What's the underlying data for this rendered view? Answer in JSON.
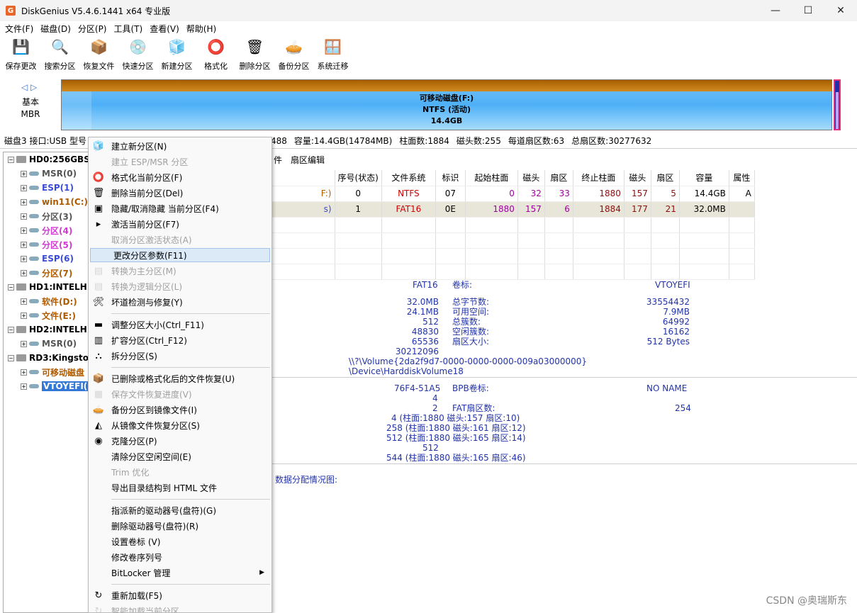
{
  "window": {
    "title": "DiskGenius V5.4.6.1441 x64 专业版",
    "minimize": "—",
    "maximize": "☐",
    "close": "✕"
  },
  "menubar": [
    "文件(F)",
    "磁盘(D)",
    "分区(P)",
    "工具(T)",
    "查看(V)",
    "帮助(H)"
  ],
  "toolbar": [
    {
      "label": "保存更改",
      "icon": "save-icon"
    },
    {
      "label": "搜索分区",
      "icon": "search-icon"
    },
    {
      "label": "恢复文件",
      "icon": "recover-icon"
    },
    {
      "label": "快速分区",
      "icon": "quick-partition-icon"
    },
    {
      "label": "新建分区",
      "icon": "new-partition-icon"
    },
    {
      "label": "格式化",
      "icon": "format-icon"
    },
    {
      "label": "删除分区",
      "icon": "delete-icon"
    },
    {
      "label": "备份分区",
      "icon": "backup-icon"
    },
    {
      "label": "系统迁移",
      "icon": "migrate-icon"
    }
  ],
  "diskbar": {
    "basic": "基本",
    "mbr": "MBR",
    "line1": "可移动磁盘(F:)",
    "line2": "NTFS (活动)",
    "line3": "14.4GB"
  },
  "diskinfo": {
    "disk": "磁盘3 接口:USB 型号",
    "tail": "488",
    "capacity": "容量:14.4GB(14784MB)",
    "cylinders": "柱面数:1884",
    "heads": "磁头数:255",
    "sectors": "每道扇区数:63",
    "total": "总扇区数:30277632"
  },
  "tree": [
    {
      "label": "HD0:256GBS",
      "level": 0,
      "bold": true,
      "color": "#000"
    },
    {
      "label": "MSR(0)",
      "level": 1,
      "bold": true,
      "color": "#555"
    },
    {
      "label": "ESP(1)",
      "level": 1,
      "bold": true,
      "color": "#3a4bd8"
    },
    {
      "label": "win11(C:)",
      "level": 1,
      "bold": true,
      "color": "#b05a00"
    },
    {
      "label": "分区(3)",
      "level": 1,
      "bold": true,
      "color": "#555"
    },
    {
      "label": "分区(4)",
      "level": 1,
      "bold": true,
      "color": "#d03ad0"
    },
    {
      "label": "分区(5)",
      "level": 1,
      "bold": true,
      "color": "#d03ad0"
    },
    {
      "label": "ESP(6)",
      "level": 1,
      "bold": true,
      "color": "#3a4bd8"
    },
    {
      "label": "分区(7)",
      "level": 1,
      "bold": true,
      "color": "#b05a00"
    },
    {
      "label": "HD1:INTELH",
      "level": 0,
      "bold": true,
      "color": "#000"
    },
    {
      "label": "软件(D:)",
      "level": 1,
      "bold": true,
      "color": "#b05a00"
    },
    {
      "label": "文件(E:)",
      "level": 1,
      "bold": true,
      "color": "#b05a00"
    },
    {
      "label": "HD2:INTELH",
      "level": 0,
      "bold": true,
      "color": "#000"
    },
    {
      "label": "MSR(0)",
      "level": 1,
      "bold": true,
      "color": "#555"
    },
    {
      "label": "RD3:Kingsto",
      "level": 0,
      "bold": true,
      "color": "#000"
    },
    {
      "label": "可移动磁盘",
      "level": 1,
      "bold": true,
      "color": "#b05a00"
    },
    {
      "label": "VTOYEFI(",
      "level": 1,
      "bold": true,
      "color": "#fff",
      "selected": true
    }
  ],
  "tabs": [
    "件",
    "扇区编辑"
  ],
  "table": {
    "headers": [
      "序号(状态)",
      "文件系统",
      "标识",
      "起始柱面",
      "磁头",
      "扇区",
      "终止柱面",
      "磁头",
      "扇区",
      "容量",
      "属性"
    ],
    "rows": [
      {
        "name": "F:)",
        "cells": [
          "0",
          "NTFS",
          "07",
          "0",
          "32",
          "33",
          "1880",
          "157",
          "5",
          "14.4GB",
          "A"
        ]
      },
      {
        "name": "s)",
        "cells": [
          "1",
          "FAT16",
          "0E",
          "1880",
          "157",
          "6",
          "1884",
          "177",
          "21",
          "32.0MB",
          ""
        ]
      }
    ]
  },
  "info": {
    "fs_value": "FAT16",
    "volname_label": "卷标:",
    "volname_value": "VTOYEFI",
    "left_values": [
      "32.0MB",
      "24.1MB",
      "512",
      "48830",
      "65536",
      "30212096"
    ],
    "right_labels": [
      "总字节数:",
      "可用空间:",
      "总簇数:",
      "空闲簇数:",
      "扇区大小:"
    ],
    "right_values": [
      "33554432",
      "7.9MB",
      "64992",
      "16162",
      "512 Bytes"
    ],
    "volume_guid": "\\\\?\\Volume{2da2f9d7-0000-0000-0000-009a03000000}",
    "device_path": "\\Device\\HarddiskVolume18",
    "serial": "76F4-51A5",
    "bpb_label": "BPB卷标:",
    "bpb_value": "NO NAME",
    "val4": "4",
    "val2": "2",
    "fat_sectors_label": "FAT扇区数:",
    "fat_sectors_value": "254",
    "loc1": "4 (柱面:1880 磁头:157 扇区:10)",
    "loc2": "258 (柱面:1880 磁头:161 扇区:12)",
    "loc3": "512 (柱面:1880 磁头:165 扇区:14)",
    "val512": "512",
    "loc4": "544 (柱面:1880 磁头:165 扇区:46)",
    "alloc": "数据分配情况图:"
  },
  "context_menu": [
    {
      "label": "建立新分区(N)",
      "disabled": false,
      "icon": "new-partition-icon"
    },
    {
      "label": "建立 ESP/MSR 分区",
      "disabled": true
    },
    {
      "label": "格式化当前分区(F)",
      "disabled": false,
      "icon": "format-icon"
    },
    {
      "label": "删除当前分区(Del)",
      "disabled": false,
      "icon": "delete-icon"
    },
    {
      "label": "隐藏/取消隐藏 当前分区(F4)",
      "disabled": false,
      "icon": "hide-icon"
    },
    {
      "label": "激活当前分区(F7)",
      "disabled": false,
      "icon": "activate-icon"
    },
    {
      "label": "取消分区激活状态(A)",
      "disabled": true
    },
    {
      "label": "更改分区参数(F11)",
      "disabled": false,
      "highlight": true
    },
    {
      "label": "转换为主分区(M)",
      "disabled": true,
      "icon": "convert-primary-icon"
    },
    {
      "label": "转换为逻辑分区(L)",
      "disabled": true,
      "icon": "convert-logical-icon"
    },
    {
      "label": "坏道检测与修复(Y)",
      "disabled": false,
      "icon": "repair-icon"
    },
    {
      "sep": true
    },
    {
      "label": "调整分区大小(Ctrl_F11)",
      "disabled": false,
      "icon": "resize-icon"
    },
    {
      "label": "扩容分区(Ctrl_F12)",
      "disabled": false,
      "icon": "extend-icon"
    },
    {
      "label": "拆分分区(S)",
      "disabled": false,
      "icon": "split-icon"
    },
    {
      "sep": true
    },
    {
      "label": "已删除或格式化后的文件恢复(U)",
      "disabled": false,
      "icon": "recover-icon"
    },
    {
      "label": "保存文件恢复进度(V)",
      "disabled": true,
      "icon": "save-progress-icon"
    },
    {
      "label": "备份分区到镜像文件(I)",
      "disabled": false,
      "icon": "backup-icon"
    },
    {
      "label": "从镜像文件恢复分区(S)",
      "disabled": false,
      "icon": "restore-icon"
    },
    {
      "label": "克隆分区(P)",
      "disabled": false,
      "icon": "clone-icon"
    },
    {
      "label": "清除分区空闲空间(E)",
      "disabled": false
    },
    {
      "label": "Trim 优化",
      "disabled": true
    },
    {
      "label": "导出目录结构到 HTML 文件",
      "disabled": false
    },
    {
      "sep": true
    },
    {
      "label": "指派新的驱动器号(盘符)(G)",
      "disabled": false
    },
    {
      "label": "删除驱动器号(盘符)(R)",
      "disabled": false
    },
    {
      "label": "设置卷标 (V)",
      "disabled": false
    },
    {
      "label": "修改卷序列号",
      "disabled": false
    },
    {
      "label": "BitLocker 管理",
      "disabled": false,
      "submenu": true
    },
    {
      "sep": true
    },
    {
      "label": "重新加载(F5)",
      "disabled": false,
      "icon": "reload-icon"
    },
    {
      "label": "智能加载当前分区",
      "disabled": true,
      "icon": "smart-load-icon"
    }
  ],
  "watermark": "CSDN @奥瑞斯东"
}
